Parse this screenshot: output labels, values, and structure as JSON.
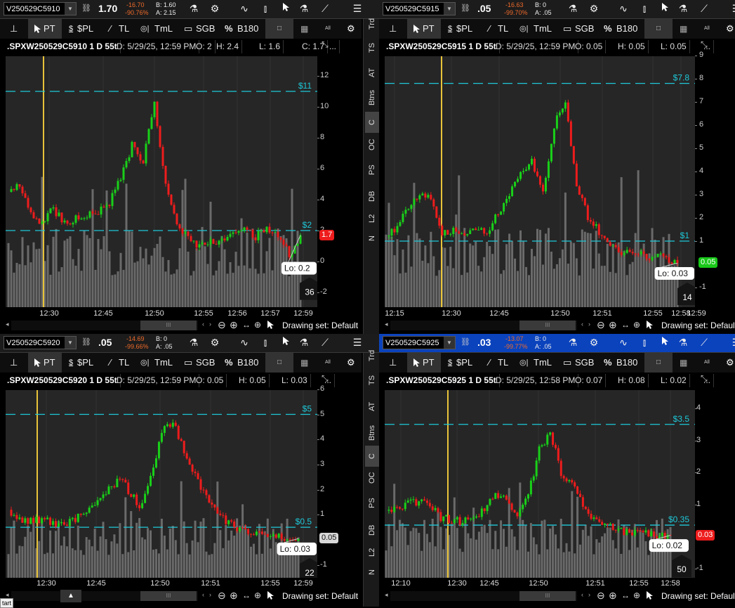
{
  "side_strip": [
    "Trd",
    "TS",
    "AT",
    "Btns",
    "C",
    "OC",
    "PS",
    "DB",
    "L2",
    "N"
  ],
  "side_strip_active_index": 4,
  "toolbar": {
    "pt": "PT",
    "spl": "$PL",
    "tl": "TL",
    "tml": "TmL",
    "sgb": "SGB",
    "pct": "%",
    "b180": "B180",
    "all": "All"
  },
  "drawing_set": "Drawing set: Default",
  "tooltip": "tart",
  "colors": {
    "up": "#19d019",
    "down": "#ee1c1c",
    "price_line": "#1ec8d8",
    "time_marker": "#e8c33a",
    "active_header": "#0b43bd",
    "change": "#ee6a2a"
  },
  "panels": [
    {
      "symbol": "V250529C5910",
      "last": "1.70",
      "change": "-16.70",
      "change_pct": "-90.76%",
      "bid": "B: 1.60",
      "ask": "A: 2.15",
      "info": {
        "title": ".SPXW250529C5910 1 D 55t",
        "date": "D: 5/29/25, 12:59 PM",
        "o": "O: 2",
        "h": "H: 2.4",
        "l": "L: 1.6",
        "c": "C: 1.7",
        "more": "..."
      },
      "y_ticks": [
        {
          "v": 12,
          "label": "12"
        },
        {
          "v": 10,
          "label": "10"
        },
        {
          "v": 8,
          "label": "8"
        },
        {
          "v": 6,
          "label": "6"
        },
        {
          "v": 4,
          "label": "4"
        },
        {
          "v": 2,
          "label": "2"
        },
        {
          "v": 0,
          "label": "0"
        },
        {
          "v": -2,
          "label": "-2"
        }
      ],
      "price_lines": [
        {
          "value": 11,
          "label": "$11"
        },
        {
          "value": 2,
          "label": "$2"
        }
      ],
      "current": {
        "value": 1.7,
        "label": "1.7",
        "bg": "#ee1c1c",
        "fg": "#ffffff"
      },
      "lo": {
        "value": 0.2,
        "label": "Lo: 0.2"
      },
      "volume_label": "36",
      "x_ticks": [
        "12:30",
        "12:45",
        "12:50",
        "12:55",
        "12:56",
        "12:57",
        "12:59"
      ],
      "closes": [
        4.5,
        5.0,
        3.2,
        2.5,
        3.4,
        2.5,
        2.8,
        3.0,
        3.3,
        3.8,
        5.5,
        7.5,
        6.5,
        10.2,
        5.0,
        2.5,
        1.5,
        1.0,
        1.2,
        1.5,
        1.8,
        2.2,
        1.6,
        2.2,
        1.8,
        0.4,
        1.7
      ]
    },
    {
      "symbol": "V250529C5915",
      "last": ".05",
      "change": "-16.63",
      "change_pct": "-99.70%",
      "bid": "B: 0",
      "ask": "A: .05",
      "info": {
        "title": ".SPXW250529C5915 1 D 55t",
        "date": "D: 5/29/25, 12:59 PM",
        "o": "O: 0.05",
        "h": "H: 0.05",
        "l": "L: 0.05",
        "more": "..."
      },
      "y_ticks": [
        {
          "v": 9,
          "label": "9"
        },
        {
          "v": 8,
          "label": "8"
        },
        {
          "v": 7,
          "label": "7"
        },
        {
          "v": 6,
          "label": "6"
        },
        {
          "v": 5,
          "label": "5"
        },
        {
          "v": 4,
          "label": "4"
        },
        {
          "v": 3,
          "label": "3"
        },
        {
          "v": 2,
          "label": "2"
        },
        {
          "v": 1,
          "label": "1"
        },
        {
          "v": -1,
          "label": "-1"
        }
      ],
      "price_lines": [
        {
          "value": 7.8,
          "label": "$7.8"
        },
        {
          "value": 1,
          "label": "$1"
        }
      ],
      "current": {
        "value": 0.05,
        "label": "0.05",
        "bg": "#19c819",
        "fg": "#ffffff"
      },
      "lo": {
        "value": 0.03,
        "label": "Lo: 0.03"
      },
      "volume_label": "14",
      "x_ticks": [
        "12:15",
        "12:30",
        "12:45",
        "12:50",
        "12:51",
        "12:55",
        "12:58",
        "12:59"
      ],
      "closes": [
        1.2,
        1.6,
        2.5,
        3.0,
        2.8,
        1.3,
        1.5,
        1.2,
        1.5,
        1.4,
        2.2,
        3.0,
        4.0,
        4.5,
        3.0,
        6.0,
        7.0,
        3.5,
        2.0,
        1.4,
        0.9,
        0.5,
        0.4,
        0.4,
        0.3,
        0.3,
        0.05
      ]
    },
    {
      "symbol": "V250529C5920",
      "last": ".05",
      "change": "-14.69",
      "change_pct": "-99.66%",
      "bid": "B: 0",
      "ask": "A: .05",
      "info": {
        "title": ".SPXW250529C5920 1 D 55t",
        "date": "D: 5/29/25, 12:59 PM",
        "o": "O: 0.05",
        "h": "H: 0.05",
        "l": "L: 0.03",
        "more": "..."
      },
      "y_ticks": [
        {
          "v": 6,
          "label": "6"
        },
        {
          "v": 5,
          "label": "5"
        },
        {
          "v": 4,
          "label": "4"
        },
        {
          "v": 3,
          "label": "3"
        },
        {
          "v": 2,
          "label": "2"
        },
        {
          "v": 1,
          "label": "1"
        },
        {
          "v": -1,
          "label": "-1"
        }
      ],
      "price_lines": [
        {
          "value": 5,
          "label": "$5"
        },
        {
          "value": 0.5,
          "label": "$0.5"
        }
      ],
      "current": {
        "value": 0.05,
        "label": "0.05",
        "bg": "#d8d8d8",
        "fg": "#111111"
      },
      "lo": {
        "value": 0.03,
        "label": "Lo: 0.03"
      },
      "volume_label": "22",
      "x_ticks": [
        "12:30",
        "12:45",
        "12:50",
        "12:51",
        "12:55",
        "12:59"
      ],
      "closes": [
        1.2,
        0.8,
        0.8,
        0.8,
        0.7,
        0.6,
        0.8,
        1.1,
        1.5,
        2.0,
        2.5,
        1.8,
        1.3,
        3.0,
        4.5,
        4.5,
        3.2,
        2.3,
        1.6,
        0.9,
        0.6,
        0.4,
        0.3,
        0.2,
        0.1,
        0.08,
        0.05
      ]
    },
    {
      "symbol": "V250529C5925",
      "last": ".03",
      "change": "-13.07",
      "change_pct": "-99.77%",
      "bid": "B: 0",
      "ask": "A: .05",
      "active": true,
      "info": {
        "title": ".SPXW250529C5925 1 D 55t",
        "date": "D: 5/29/25, 12:58 PM",
        "o": "O: 0.07",
        "h": "H: 0.08",
        "l": "L: 0.02",
        "more": "..."
      },
      "y_ticks": [
        {
          "v": 4,
          "label": "4"
        },
        {
          "v": 3,
          "label": "3"
        },
        {
          "v": 2,
          "label": "2"
        },
        {
          "v": 1,
          "label": "1"
        },
        {
          "v": -1,
          "label": "-1"
        }
      ],
      "price_lines": [
        {
          "value": 3.5,
          "label": "$3.5"
        },
        {
          "value": 0.35,
          "label": "$0.35"
        }
      ],
      "current": {
        "value": 0.03,
        "label": "0.03",
        "bg": "#ee1c1c",
        "fg": "#ffffff"
      },
      "lo": {
        "value": 0.02,
        "label": "Lo: 0.02"
      },
      "volume_label": "50",
      "x_ticks": [
        "12:10",
        "12:30",
        "12:45",
        "12:50",
        "12:51",
        "12:55",
        "12:58"
      ],
      "closes": [
        0.8,
        0.9,
        1.0,
        1.1,
        1.0,
        0.6,
        0.5,
        0.45,
        0.6,
        0.8,
        1.3,
        1.1,
        0.6,
        1.3,
        2.7,
        3.3,
        2.0,
        1.7,
        0.9,
        0.6,
        0.35,
        0.2,
        0.15,
        0.12,
        0.1,
        0.05,
        0.03
      ]
    }
  ]
}
